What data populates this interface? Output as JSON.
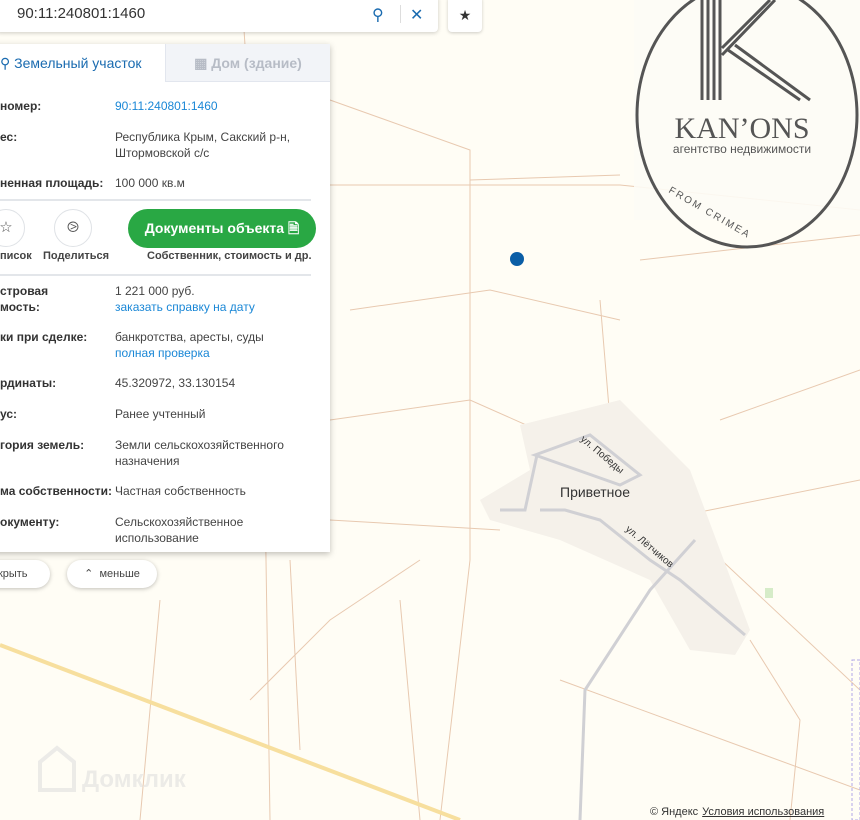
{
  "search": {
    "value": "90:11:240801:1460",
    "search_icon": "search-icon",
    "clear_icon": "close-icon"
  },
  "favorites_icon": "star-icon",
  "tabs": [
    {
      "label": "Земельный участок",
      "icon": "land-icon"
    },
    {
      "label": "Дом (здание)",
      "icon": "building-icon"
    }
  ],
  "rows_top": [
    {
      "label": "номер:",
      "value": "90:11:240801:1460"
    },
    {
      "label": "ес:",
      "value": "Республика Крым, Сакский р-н, Штормовской с/с"
    },
    {
      "label": "ненная площадь:",
      "value": "100 000 кв.м"
    }
  ],
  "actions": {
    "list_label": "писок",
    "share_label": "Поделиться",
    "docs_button": "Документы объекта",
    "docs_caption": "Собственник, стоимость и др."
  },
  "rows": [
    {
      "label": "стровая",
      "label2": "мость:",
      "value": "1 221 000 руб.",
      "link": "заказать справку на дату"
    },
    {
      "label": "ки при сделке:",
      "value": "банкротства, аресты, суды",
      "link": "полная проверка"
    },
    {
      "label": "рдинаты:",
      "value": "45.320972, 33.130154"
    },
    {
      "label": "ус:",
      "value": "Ранее учтенный"
    },
    {
      "label": "гория земель:",
      "value": "Земли сельскохозяйственного назначения"
    },
    {
      "label": "ма собственности:",
      "value": "Частная собственность"
    },
    {
      "label": "окументу:",
      "value": "Сельскохозяйственное использование"
    }
  ],
  "below": {
    "hide": "скрыть",
    "less": "меньше"
  },
  "map": {
    "village": "Приветное",
    "street1": "ул. Победы",
    "street2": "ул. Лётчиков",
    "watermark": "Домклик",
    "copyright": "© Яндекс",
    "terms": "Условия использования",
    "marker_color": "#0b5ea6"
  },
  "logo": {
    "name": "KAN’ONS",
    "sub": "агентство недвижимости",
    "tag": "FROM CRIMEA"
  }
}
